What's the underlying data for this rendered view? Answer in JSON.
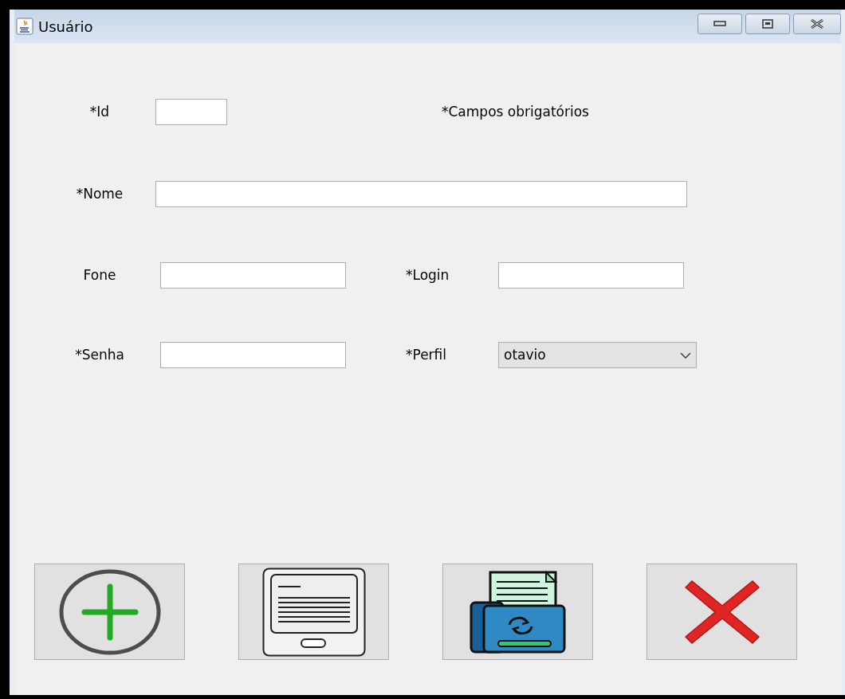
{
  "window": {
    "title": "Usuário"
  },
  "required_note": "*Campos obrigatórios",
  "form_rows": [
    [
      {
        "label": "*Id",
        "kind": "short"
      }
    ],
    [
      {
        "label": "*Nome",
        "kind": "wide"
      }
    ],
    [
      {
        "label": "Fone",
        "kind": "text"
      },
      {
        "label": "*Login",
        "kind": "text"
      }
    ],
    [
      {
        "label": "*Senha",
        "kind": "text"
      },
      {
        "label": "*Perfil",
        "kind": "select",
        "value": "otavio"
      }
    ]
  ],
  "buttons": [
    {
      "kind": "add"
    },
    {
      "kind": "read"
    },
    {
      "kind": "update"
    },
    {
      "kind": "delete"
    }
  ]
}
